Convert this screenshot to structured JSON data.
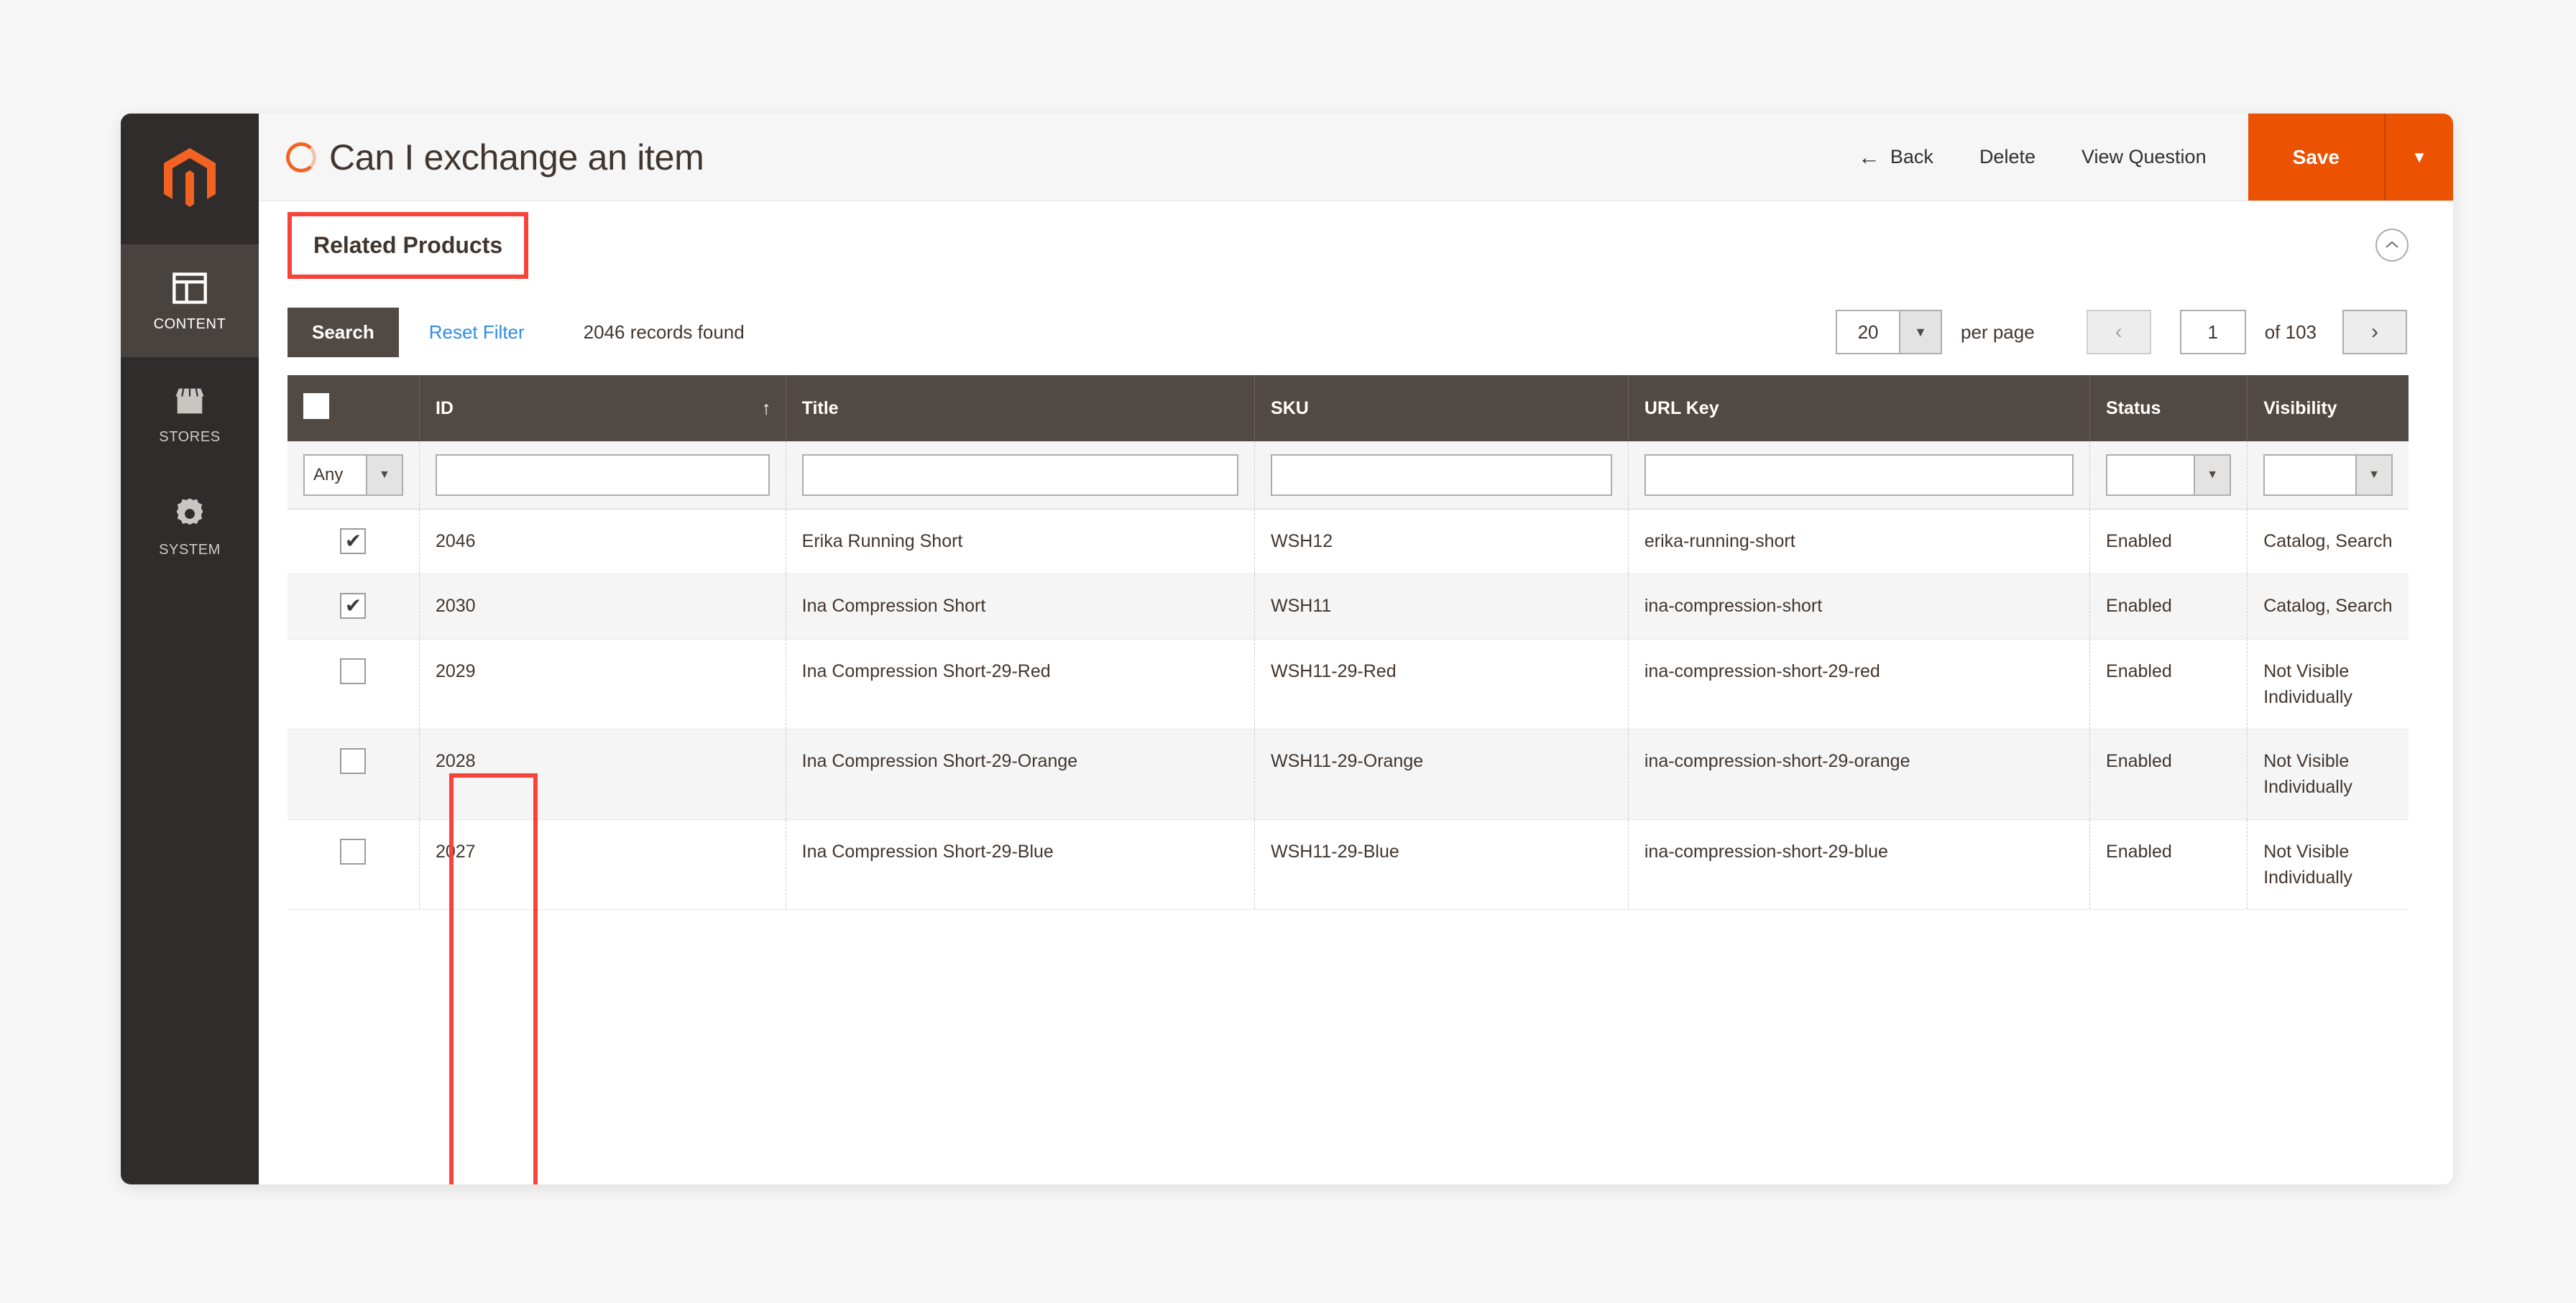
{
  "sidebar": {
    "logo_name": "magento-logo",
    "items": [
      {
        "label": "CONTENT",
        "icon": "content-layout-icon",
        "active": true
      },
      {
        "label": "STORES",
        "icon": "store-icon",
        "active": false
      },
      {
        "label": "SYSTEM",
        "icon": "gear-icon",
        "active": false
      }
    ]
  },
  "header": {
    "title": "Can I exchange an item",
    "spinner_color": "#f26322",
    "actions": [
      {
        "label": "Back",
        "icon": "back-arrow-icon"
      },
      {
        "label": "Delete",
        "icon": ""
      },
      {
        "label": "View Question",
        "icon": ""
      }
    ],
    "save_label": "Save",
    "save_color": "#eb5202",
    "save_dropdown_icon": "chevron-down-icon"
  },
  "section": {
    "title": "Related Products",
    "highlight_color": "#f9423a",
    "collapse_icon": "chevron-up-icon"
  },
  "toolbar": {
    "search_label": "Search",
    "reset_label": "Reset Filter",
    "records_found": "2046 records found",
    "per_page_value": "20",
    "per_page_label": "per page",
    "prev_icon": "chevron-left-icon",
    "next_icon": "chevron-right-icon",
    "page_value": "1",
    "of_pages": "of 103"
  },
  "grid": {
    "columns": [
      {
        "key": "checkbox",
        "label": "",
        "sort": ""
      },
      {
        "key": "id",
        "label": "ID",
        "sort": "↑"
      },
      {
        "key": "title",
        "label": "Title",
        "sort": ""
      },
      {
        "key": "sku",
        "label": "SKU",
        "sort": ""
      },
      {
        "key": "url_key",
        "label": "URL Key",
        "sort": ""
      },
      {
        "key": "status",
        "label": "Status",
        "sort": ""
      },
      {
        "key": "visibility",
        "label": "Visibility",
        "sort": ""
      }
    ],
    "filters": {
      "checkbox_select": "Any",
      "id": "",
      "title": "",
      "sku": "",
      "url_key": "",
      "status": "",
      "visibility": ""
    },
    "rows": [
      {
        "checked": true,
        "id": "2046",
        "title": "Erika Running Short",
        "sku": "WSH12",
        "url_key": "erika-running-short",
        "status": "Enabled",
        "visibility": "Catalog, Search"
      },
      {
        "checked": true,
        "id": "2030",
        "title": "Ina Compression Short",
        "sku": "WSH11",
        "url_key": "ina-compression-short",
        "status": "Enabled",
        "visibility": "Catalog, Search"
      },
      {
        "checked": false,
        "id": "2029",
        "title": "Ina Compression Short-29-Red",
        "sku": "WSH11-29-Red",
        "url_key": "ina-compression-short-29-red",
        "status": "Enabled",
        "visibility": "Not Visible Individually"
      },
      {
        "checked": false,
        "id": "2028",
        "title": "Ina Compression Short-29-Orange",
        "sku": "WSH11-29-Orange",
        "url_key": "ina-compression-short-29-orange",
        "status": "Enabled",
        "visibility": "Not Visible Individually"
      },
      {
        "checked": false,
        "id": "2027",
        "title": "Ina Compression Short-29-Blue",
        "sku": "WSH11-29-Blue",
        "url_key": "ina-compression-short-29-blue",
        "status": "Enabled",
        "visibility": "Not Visible Individually"
      }
    ]
  }
}
